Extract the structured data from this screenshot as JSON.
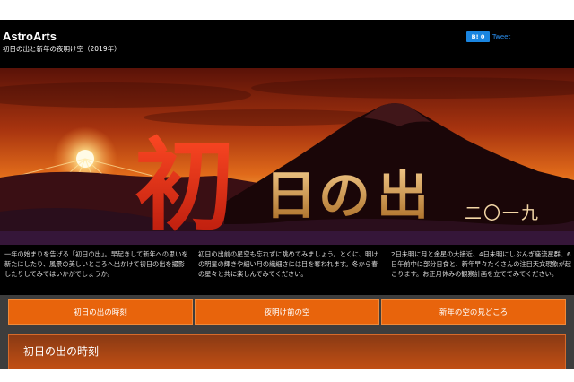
{
  "header": {
    "brand": "AstroArts",
    "subtitle": "初日の出と新年の夜明け空（2019年）",
    "share": {
      "hatena_label": "B! 0",
      "tweet_label": "Tweet"
    }
  },
  "hero": {
    "title": "初日の出",
    "year": "二〇一九",
    "sun_icon": "sun-icon",
    "mountain_icon": "mountain-icon",
    "colors": {
      "sky_top": "#7a1d0c",
      "sky_mid": "#e06a1a",
      "horizon": "#f7c25a",
      "title_red": "#d93418",
      "title_gold": "#c8902c"
    }
  },
  "intro": {
    "col1": "一年の始まりを告げる「初日の出」。早起きして新年への思いを新たにしたり、風景の美しいところへ出かけて初日の出を撮影したりしてみてはいかがでしょうか。",
    "col2": "初日の出前の星空も忘れずに眺めてみましょう。とくに、明けの明星の輝きや細い月の繊細さには目を奪われます。冬から春の星々と共に楽しんでみてください。",
    "col3": "2日未明に月と金星の大接近、4日未明にしぶんぎ座流星群、6日午前中に部分日食と、新年早々たくさんの注目天文現象が起こります。お正月休みの観察計画を立ててみてください。"
  },
  "nav": [
    {
      "label": "初日の出の時刻"
    },
    {
      "label": "夜明け前の空"
    },
    {
      "label": "新年の空の見どころ"
    }
  ],
  "section": {
    "title": "初日の出の時刻"
  },
  "colors": {
    "accent": "#e8640c",
    "background": "#000000"
  }
}
